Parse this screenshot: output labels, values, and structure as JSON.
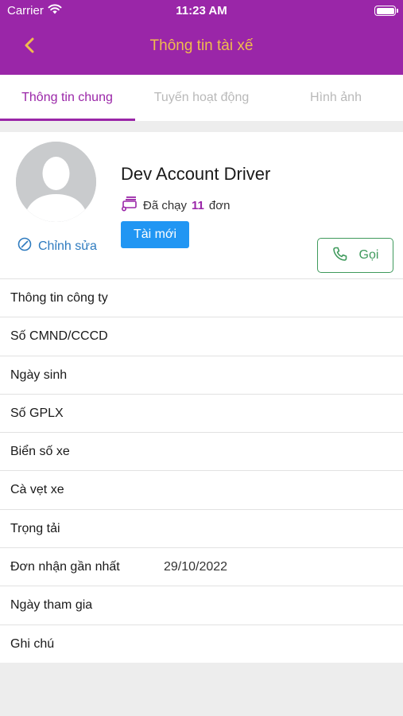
{
  "status_bar": {
    "carrier": "Carrier",
    "time": "11:23 AM"
  },
  "header": {
    "title": "Thông tin tài xế",
    "back_icon": "chevron-left-icon",
    "accent_color": "#9a26a8",
    "title_color": "#f0bd4c"
  },
  "tabs": [
    {
      "label": "Thông tin chung",
      "active": true
    },
    {
      "label": "Tuyến hoạt động",
      "active": false
    },
    {
      "label": "Hình ảnh",
      "active": false
    }
  ],
  "profile": {
    "name": "Dev Account Driver",
    "runs_prefix": "Đã chạy",
    "runs_count": "11",
    "runs_suffix": "đơn",
    "badge": "Tài mới",
    "edit_label": "Chỉnh sửa",
    "call_label": "Gọi"
  },
  "info_rows": [
    {
      "label": "Thông tin công ty",
      "value": ""
    },
    {
      "label": "Số CMND/CCCD",
      "value": ""
    },
    {
      "label": "Ngày sinh",
      "value": ""
    },
    {
      "label": "Số GPLX",
      "value": ""
    },
    {
      "label": "Biển số xe",
      "value": ""
    },
    {
      "label": "Cà vẹt xe",
      "value": ""
    },
    {
      "label": "Trọng tải",
      "value": ""
    },
    {
      "label": "Đơn nhận gần nhất",
      "value": "29/10/2022"
    },
    {
      "label": "Ngày tham gia",
      "value": ""
    },
    {
      "label": "Ghi chú",
      "value": ""
    }
  ]
}
